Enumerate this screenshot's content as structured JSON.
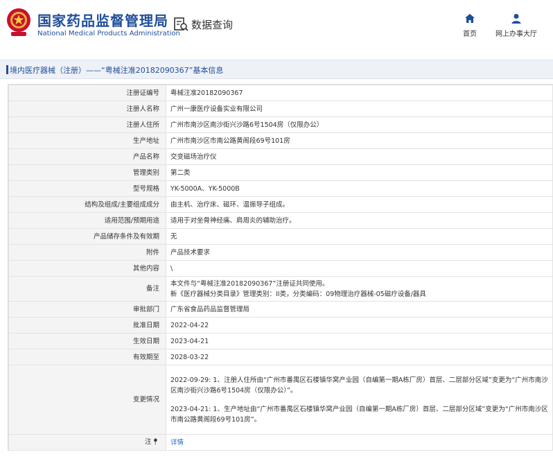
{
  "header": {
    "brand_cn": "国家药品监督管理局",
    "brand_en": "National Medical Products Administration",
    "section_title": "数据查询",
    "nav": {
      "home": "首页",
      "office": "网上办事大厅"
    }
  },
  "breadcrumb": "境内医疗器械（注册）——“粤械注准20182090367”基本信息",
  "rows": [
    {
      "label": "注册证编号",
      "value": "粤械注准20182090367"
    },
    {
      "label": "注册人名称",
      "value": "广州一康医疗设备实业有限公司"
    },
    {
      "label": "注册人住所",
      "value": "广州市南沙区南沙街兴沙路6号1504房（仅限办公）"
    },
    {
      "label": "生产地址",
      "value": "广州市南沙区市南公路黄阁段69号101房"
    },
    {
      "label": "产品名称",
      "value": "交变磁场治疗仪"
    },
    {
      "label": "管理类别",
      "value": "第二类"
    },
    {
      "label": "型号规格",
      "value": "YK-5000A、YK-5000B"
    },
    {
      "label": "结构及组成/主要组成成分",
      "value": "由主机、治疗床、磁环、温振导子组成。"
    },
    {
      "label": "适用范围/预期用途",
      "value": "适用于对坐骨神经痛、肩周炎的辅助治疗。"
    },
    {
      "label": "产品储存条件及有效期",
      "value": "无"
    },
    {
      "label": "附件",
      "value": "产品技术要求"
    },
    {
      "label": "其他内容",
      "value": "\\"
    }
  ],
  "remarks": {
    "label": "备注",
    "line1": "本文件与“粤械注准20182090367”注册证共同使用。",
    "line2": "新《医疗器械分类目录》管理类别：II类，分类编码：09物理治疗器械-05磁疗设备/器具"
  },
  "rows2": [
    {
      "label": "审批部门",
      "value": "广东省食品药品监督管理局"
    },
    {
      "label": "批准日期",
      "value": "2022-04-22"
    },
    {
      "label": "生效日期",
      "value": "2023-04-21"
    },
    {
      "label": "有效期至",
      "value": "2028-03-22"
    }
  ],
  "changes": {
    "label": "变更情况",
    "p1": "2022-09-29: 1、注册人住所由“广州市番禺区石楼镇华窝产业园（自编第一期A栋厂房）首层、二层部分区域”变更为“广州市南沙区南沙街兴沙路6号1504房（仅限办公）”。",
    "p2": "2023-04-21: 1、生产地址由“广州市番禺区石楼镇华窝产业园（自编第一期A栋厂房）首层、二层部分区域”变更为“广州市南沙区市南公路黄阁段69号101房”。"
  },
  "detail": {
    "label": "注",
    "link": "详情"
  },
  "colors": {
    "brand_blue": "#1f4e9a",
    "link_blue": "#1f66c1",
    "label_bg": "#f4f4f4"
  }
}
